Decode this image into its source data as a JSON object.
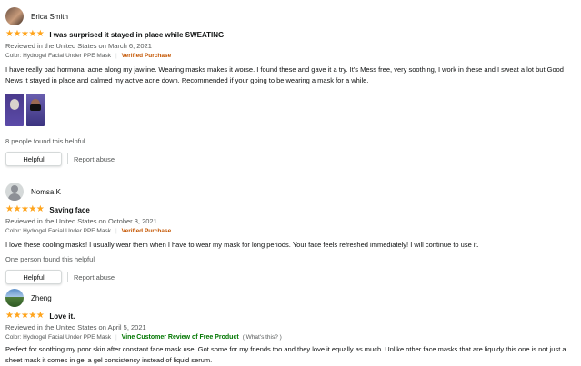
{
  "reviews": [
    {
      "name": "Erica Smith",
      "rating": 5,
      "title": "I was surprised it stayed in place while SWEATING",
      "meta": "Reviewed in the United States on March 6, 2021",
      "variant": "Color: Hydrogel Facial Under PPE Mask",
      "badge": "Verified Purchase",
      "text": "I have really bad hormonal acne along my jawline. Wearing masks makes it worse. I found these and gave it a try. It's Mess free, very soothing, I work in these and I sweat a lot but Good News it stayed in place and calmed my active acne down. Recommended if your going to be wearing a mask for a while.",
      "helpful_count": "8 people found this helpful",
      "helpful_label": "Helpful",
      "report_label": "Report abuse"
    },
    {
      "name": "Nomsa K",
      "rating": 5,
      "title": "Saving face",
      "meta": "Reviewed in the United States on October 3, 2021",
      "variant": "Color: Hydrogel Facial Under PPE Mask",
      "badge": "Verified Purchase",
      "text": "I love these cooling masks! I usually wear them when I have to wear my mask for long periods. Your face feels refreshed immediately! I will continue to use it.",
      "helpful_count": "One person found this helpful",
      "helpful_label": "Helpful",
      "report_label": "Report abuse"
    },
    {
      "name": "Zheng",
      "rating": 5,
      "title": "Love it.",
      "meta": "Reviewed in the United States on April 5, 2021",
      "variant": "Color: Hydrogel Facial Under PPE Mask",
      "vine_label": "Vine Customer Review of Free Product",
      "whats_this": "( What's this? )",
      "text": "Perfect for soothing my poor skin after constant face mask use. Got some for my friends too and they love it equally as much. Unlike other face masks that are liquidy this one is not just a sheet mask it comes in gel a gel consistency instead of liquid serum."
    }
  ],
  "icons": {
    "star": "star-icon",
    "avatar_default": "default-avatar-icon"
  },
  "colors": {
    "star": "#ffa41c",
    "verified": "#c45500",
    "vine": "#007600",
    "muted": "#565959"
  }
}
